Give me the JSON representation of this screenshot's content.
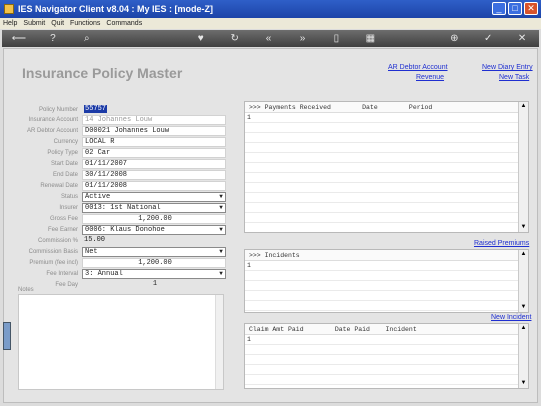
{
  "window": {
    "title": "IES Navigator Client v8.04 : My IES :     [mode-Z]"
  },
  "menu": [
    "Help",
    "Submit",
    "Quit",
    "Functions",
    "Commands"
  ],
  "toolbar": [
    {
      "icon": "back-arrow-icon",
      "glyph": "⟵"
    },
    {
      "icon": "help-icon",
      "glyph": "?"
    },
    {
      "icon": "search-icon",
      "glyph": "⌕"
    },
    {
      "icon": "heart-icon",
      "glyph": "♥"
    },
    {
      "icon": "refresh-icon",
      "glyph": "↻"
    },
    {
      "icon": "rewind-icon",
      "glyph": "«"
    },
    {
      "icon": "forward-icon",
      "glyph": "»"
    },
    {
      "icon": "doc-icon",
      "glyph": "▯"
    },
    {
      "icon": "grid-icon",
      "glyph": "▦"
    },
    {
      "icon": "save-icon",
      "glyph": "⊕"
    },
    {
      "icon": "ok-icon",
      "glyph": "✓"
    },
    {
      "icon": "close-icon",
      "glyph": "✕"
    }
  ],
  "page": {
    "title": "Insurance Policy Master"
  },
  "links": {
    "ar_debtor_account": "AR Debtor Account",
    "revenue": "Revenue",
    "new_diary_entry": "New Diary Entry",
    "new_task": "New Task",
    "raised_premiums": "Raised Premiums",
    "new_incident": "New Incident"
  },
  "form": {
    "policy_number": {
      "label": "Policy Number",
      "value": "55757"
    },
    "insurance_account": {
      "label": "Insurance Account",
      "value": "14 Johannes Louw"
    },
    "ar_debtor_account": {
      "label": "AR Debtor Account",
      "value": "D00021 Johannes Louw"
    },
    "currency": {
      "label": "Currency",
      "value": "LOCAL R"
    },
    "policy_type": {
      "label": "Policy Type",
      "value": "02 Car"
    },
    "start_date": {
      "label": "Start Date",
      "value": "01/11/2007"
    },
    "end_date": {
      "label": "End Date",
      "value": "30/11/2008"
    },
    "renewal_date": {
      "label": "Renewal Date",
      "value": "01/11/2008"
    },
    "status": {
      "label": "Status",
      "value": "Active"
    },
    "insurer": {
      "label": "Insurer",
      "value": "0013: 1st National"
    },
    "gross_fee": {
      "label": "Gross Fee",
      "value": "1,200.00"
    },
    "fee_earner": {
      "label": "Fee Earner",
      "value": "0006: Klaus Donohoe"
    },
    "commission_pct": {
      "label": "Commission %",
      "value": "15.00"
    },
    "commission_basis": {
      "label": "Commission Basis",
      "value": "Net"
    },
    "premium": {
      "label": "Premium (fee incl)",
      "value": "1,200.00"
    },
    "fee_interval": {
      "label": "Fee Interval",
      "value": "3: Annual"
    },
    "fee_day": {
      "label": "Fee Day",
      "value": "1"
    },
    "notes_label": "Notes"
  },
  "payments": {
    "header": ">>> Payments Received        Date        Period",
    "row": "1"
  },
  "incidents": {
    "header": ">>> Incidents",
    "row": "1"
  },
  "claims": {
    "header": "Claim Amt Paid        Date Paid    Incident",
    "row": "1"
  }
}
